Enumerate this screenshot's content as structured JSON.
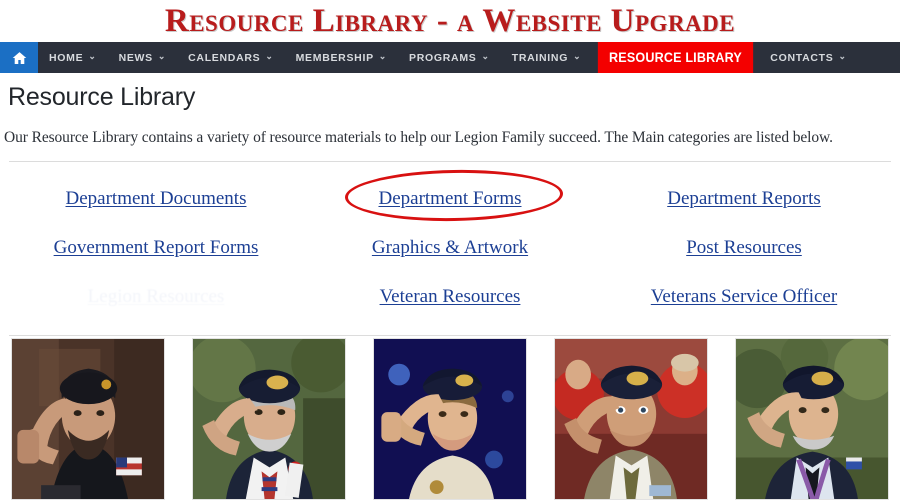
{
  "banner": {
    "title": "Resource Library - a Website Upgrade",
    "title_color": "#b81c1c"
  },
  "nav": {
    "home_icon": "home-icon",
    "accent_color": "#1b6fc4",
    "bar_color": "#2b303b",
    "active_color": "#f40000",
    "items": [
      {
        "label": "HOME",
        "caret": "⌄",
        "active": false
      },
      {
        "label": "NEWS",
        "caret": "⌄",
        "active": false
      },
      {
        "label": "CALENDARS",
        "caret": "⌄",
        "active": false
      },
      {
        "label": "MEMBERSHIP",
        "caret": "⌄",
        "active": false
      },
      {
        "label": "PROGRAMS",
        "caret": "⌄",
        "active": false
      },
      {
        "label": "TRAINING",
        "caret": "⌄",
        "active": false
      },
      {
        "label": "RESOURCE LIBRARY",
        "caret": "",
        "active": true
      },
      {
        "label": "CONTACTS",
        "caret": "⌄",
        "active": false
      }
    ]
  },
  "page": {
    "title": "Resource Library",
    "intro": "Our Resource Library contains a variety of resource materials to help our Legion Family succeed. The Main categories are listed below."
  },
  "links": {
    "link_color": "#1c3f94",
    "rows": [
      [
        {
          "label": "Department Documents",
          "ghost": false
        },
        {
          "label": "Department Forms",
          "ghost": false,
          "highlighted": true
        },
        {
          "label": "Department Reports",
          "ghost": false
        }
      ],
      [
        {
          "label": "Government Report Forms",
          "ghost": false
        },
        {
          "label": "Graphics & Artwork",
          "ghost": false
        },
        {
          "label": "Post Resources",
          "ghost": false
        }
      ],
      [
        {
          "label": "Legion Resources",
          "ghost": true
        },
        {
          "label": "Veteran Resources",
          "ghost": false
        },
        {
          "label": "Veterans Service Officer",
          "ghost": false
        }
      ]
    ]
  },
  "annotation": {
    "shape": "ellipse",
    "color": "#d81111",
    "targets": "Department Forms"
  },
  "photos": [
    {
      "name": "saluting-veteran-1",
      "alt": "Bearded young veteran in black beret saluting"
    },
    {
      "name": "saluting-veteran-2",
      "alt": "Older veteran with white mustache in navy suit saluting"
    },
    {
      "name": "saluting-veteran-3",
      "alt": "Woman veteran in tan polo saluting on blue stage"
    },
    {
      "name": "saluting-veteran-4",
      "alt": "Veteran in tan suit saluting with red-clad crowd behind"
    },
    {
      "name": "saluting-veteran-5",
      "alt": "Veteran in dark suit with lanyard saluting outdoors"
    }
  ]
}
